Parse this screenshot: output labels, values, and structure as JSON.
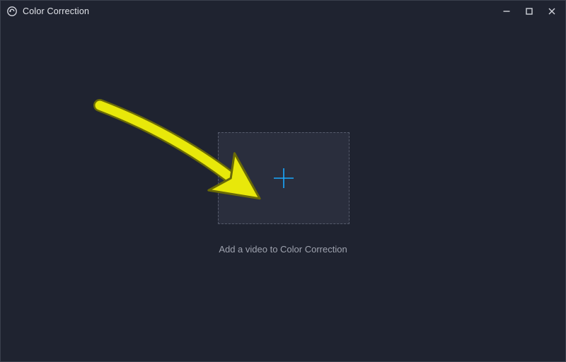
{
  "window": {
    "title": "Color Correction"
  },
  "main": {
    "dropzone_caption": "Add a video to Color Correction"
  },
  "colors": {
    "accent": "#19a8ff",
    "annotation": "#e8e80a",
    "annotation_stroke": "#6a6a07",
    "bg": "#1f2330",
    "drop_bg": "#2a2e3d",
    "border_dashed": "#565b6c"
  }
}
